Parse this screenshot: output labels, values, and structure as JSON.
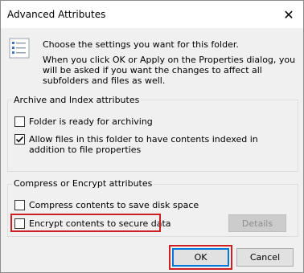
{
  "dialog": {
    "title": "Advanced Attributes",
    "close_glyph": "✕",
    "intro_line1": "Choose the settings you want for this folder.",
    "intro_line2": "When you click OK or Apply on the Properties dialog, you will be asked if you want the changes to affect all subfolders and files as well."
  },
  "archive_group": {
    "title": "Archive and Index attributes",
    "folder_ready": {
      "label": "Folder is ready for archiving",
      "checked": false
    },
    "allow_index": {
      "label": "Allow files in this folder to have contents indexed in addition to file properties",
      "checked": true
    }
  },
  "compress_group": {
    "title": "Compress or Encrypt attributes",
    "compress": {
      "label": "Compress contents to save disk space",
      "checked": false
    },
    "encrypt": {
      "label": "Encrypt contents to secure data",
      "checked": false
    },
    "details_button": "Details"
  },
  "buttons": {
    "ok": "OK",
    "cancel": "Cancel"
  },
  "colors": {
    "highlight": "#cc2020",
    "focus": "#0078d7"
  }
}
